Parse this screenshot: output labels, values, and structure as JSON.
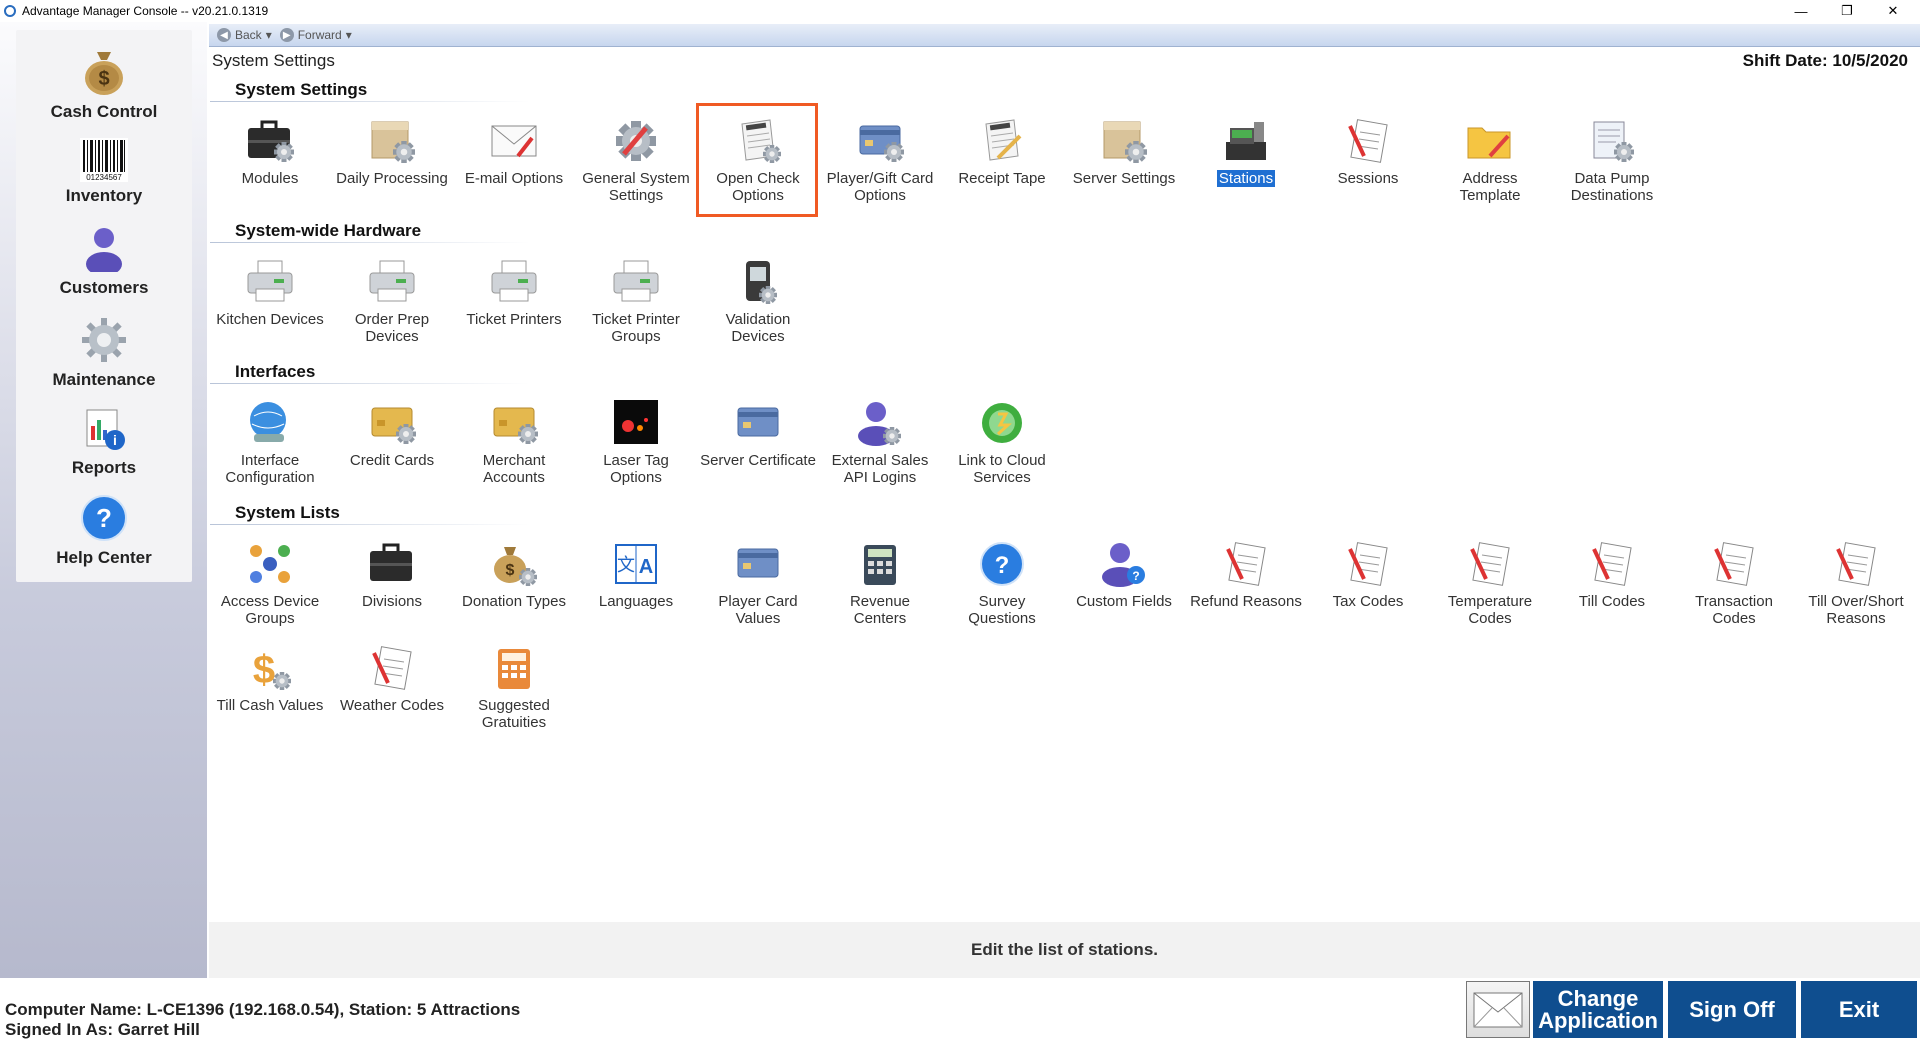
{
  "window": {
    "title": "Advantage Manager Console -- v20.21.0.1319",
    "minimize_glyph": "—",
    "restore_glyph": "❐",
    "close_glyph": "✕"
  },
  "nav": {
    "back_label": "Back",
    "forward_label": "Forward"
  },
  "header": {
    "title": "System Settings",
    "shift_date": "Shift Date: 10/5/2020"
  },
  "sidebar": {
    "items": [
      {
        "label": "Cash Control",
        "icon": "money-bag-icon"
      },
      {
        "label": "Inventory",
        "icon": "barcode-icon"
      },
      {
        "label": "Customers",
        "icon": "person-icon"
      },
      {
        "label": "Maintenance",
        "icon": "gear-icon"
      },
      {
        "label": "Reports",
        "icon": "report-icon"
      },
      {
        "label": "Help Center",
        "icon": "help-icon"
      }
    ],
    "barcode_number": "01234567"
  },
  "sections": [
    {
      "title": "System Settings",
      "tiles": [
        {
          "label": "Modules",
          "icon": "briefcase-gear-icon"
        },
        {
          "label": "Daily Processing",
          "icon": "box-gear-icon"
        },
        {
          "label": "E-mail Options",
          "icon": "envelope-icon"
        },
        {
          "label": "General System Settings",
          "icon": "gear-pencil-icon"
        },
        {
          "label": "Open Check Options",
          "icon": "receipt-gear-icon"
        },
        {
          "label": "Player/Gift Card Options",
          "icon": "card-gear-icon"
        },
        {
          "label": "Receipt Tape",
          "icon": "receipt-icon"
        },
        {
          "label": "Server Settings",
          "icon": "server-box-icon"
        },
        {
          "label": "Stations",
          "icon": "register-icon"
        },
        {
          "label": "Sessions",
          "icon": "checklist-icon"
        },
        {
          "label": "Address Template",
          "icon": "folder-pencil-icon"
        },
        {
          "label": "Data Pump Destinations",
          "icon": "report-gear-icon"
        }
      ]
    },
    {
      "title": "System-wide Hardware",
      "tiles": [
        {
          "label": "Kitchen Devices",
          "icon": "printer-icon"
        },
        {
          "label": "Order Prep Devices",
          "icon": "printer-icon"
        },
        {
          "label": "Ticket Printers",
          "icon": "printer-icon"
        },
        {
          "label": "Ticket Printer Groups",
          "icon": "printer-icon"
        },
        {
          "label": "Validation Devices",
          "icon": "handheld-icon"
        }
      ]
    },
    {
      "title": "Interfaces",
      "tiles": [
        {
          "label": "Interface Configuration",
          "icon": "globe-icon"
        },
        {
          "label": "Credit Cards",
          "icon": "credit-card-icon"
        },
        {
          "label": "Merchant Accounts",
          "icon": "credit-card-gear-icon"
        },
        {
          "label": "Laser Tag Options",
          "icon": "laser-tag-icon"
        },
        {
          "label": "Server Certificate",
          "icon": "card-icon"
        },
        {
          "label": "External Sales API Logins",
          "icon": "person-gear-icon"
        },
        {
          "label": "Link to Cloud Services",
          "icon": "cloud-sync-icon"
        }
      ]
    },
    {
      "title": "System Lists",
      "tiles": [
        {
          "label": "Access Device Groups",
          "icon": "network-icon"
        },
        {
          "label": "Divisions",
          "icon": "briefcase-icon"
        },
        {
          "label": "Donation Types",
          "icon": "money-bag-gear-icon"
        },
        {
          "label": "Languages",
          "icon": "language-icon"
        },
        {
          "label": "Player Card Values",
          "icon": "card-icon"
        },
        {
          "label": "Revenue Centers",
          "icon": "calculator-icon"
        },
        {
          "label": "Survey Questions",
          "icon": "question-icon"
        },
        {
          "label": "Custom Fields",
          "icon": "person-question-icon"
        },
        {
          "label": "Refund Reasons",
          "icon": "checklist-icon"
        },
        {
          "label": "Tax Codes",
          "icon": "checklist-icon"
        },
        {
          "label": "Temperature Codes",
          "icon": "checklist-icon"
        },
        {
          "label": "Till Codes",
          "icon": "checklist-icon"
        },
        {
          "label": "Transaction Codes",
          "icon": "checklist-icon"
        },
        {
          "label": "Till Over/Short Reasons",
          "icon": "checklist-icon"
        },
        {
          "label": "Till Cash Values",
          "icon": "dollar-gear-icon"
        },
        {
          "label": "Weather Codes",
          "icon": "checklist-icon"
        },
        {
          "label": "Suggested Gratuities",
          "icon": "calculator-orange-icon"
        }
      ]
    }
  ],
  "status_message": "Edit the list of stations.",
  "footer": {
    "computer_name": "Computer Name: L-CE1396 (192.168.0.54), Station: 5 Attractions",
    "signed_in": "Signed In As: Garret Hill",
    "change_app_line1": "Change",
    "change_app_line2": "Application",
    "sign_off_label": "Sign Off",
    "exit_label": "Exit"
  },
  "colors": {
    "accent": "#0f4e8f",
    "selection": "#1f6fd2",
    "highlight_box": "#f05a23"
  }
}
